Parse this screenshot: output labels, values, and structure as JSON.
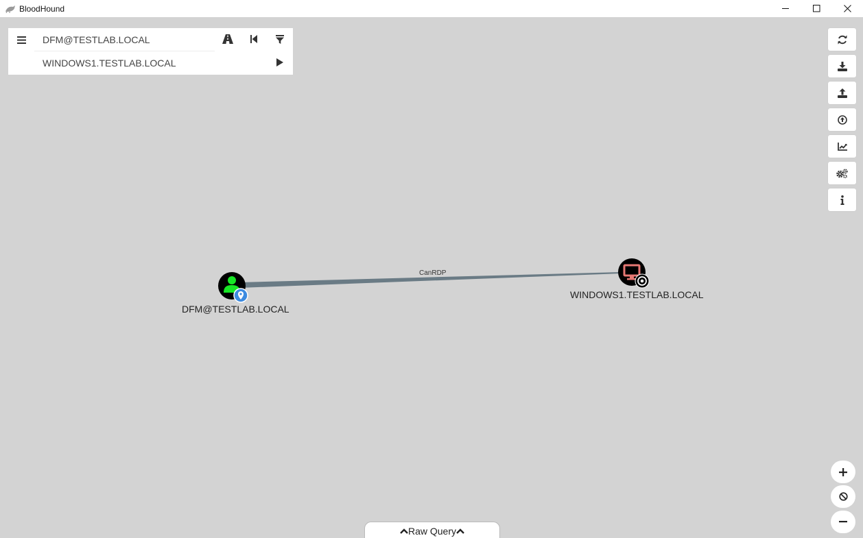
{
  "window": {
    "title": "BloodHound",
    "minimize_icon": "minimize-icon",
    "maximize_icon": "maximize-icon",
    "close_icon": "close-icon"
  },
  "search": {
    "start_node": "DFM@TESTLAB.LOCAL",
    "target_node": "WINDOWS1.TESTLAB.LOCAL",
    "icons": [
      "menu-icon",
      "pathfinding-icon",
      "back-icon",
      "filter-icon",
      "play-icon"
    ]
  },
  "toolbar": {
    "icons": [
      "refresh-icon",
      "export-icon",
      "import-icon",
      "upload-icon",
      "chart-icon",
      "settings-icon",
      "info-icon"
    ]
  },
  "zoom": {
    "icons": [
      "zoom-in-icon",
      "reset-icon",
      "zoom-out-icon"
    ]
  },
  "graph": {
    "nodes": [
      {
        "label": "DFM@TESTLAB.LOCAL",
        "type": "user",
        "color": "#17e625",
        "badge": "owned-marker-icon"
      },
      {
        "label": "WINDOWS1.TESTLAB.LOCAL",
        "type": "computer",
        "color": "#e67873",
        "badge": "target-icon"
      }
    ],
    "edges": [
      {
        "label": "CanRDP",
        "from": "DFM@TESTLAB.LOCAL",
        "to": "WINDOWS1.TESTLAB.LOCAL",
        "color": "#6a7b85"
      }
    ]
  },
  "raw_query": {
    "label": "Raw Query"
  },
  "colors": {
    "background": "#d3d3d3",
    "user_node": "#17e625",
    "computer_node": "#e67873",
    "edge": "#6a7b85"
  }
}
